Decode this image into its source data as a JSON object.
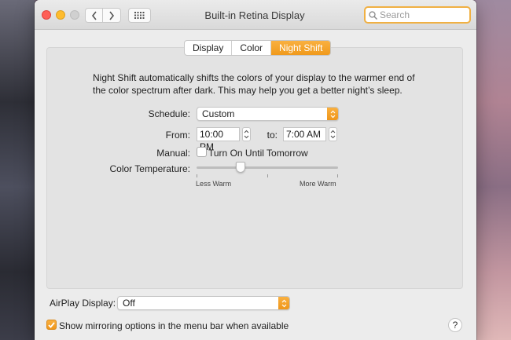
{
  "window": {
    "title": "Built-in Retina Display"
  },
  "toolbar": {
    "back_icon": "chevron-left-icon",
    "forward_icon": "chevron-right-icon",
    "grid_icon": "grid-icon"
  },
  "search": {
    "placeholder": "Search",
    "value": ""
  },
  "tabs": [
    {
      "label": "Display",
      "active": false
    },
    {
      "label": "Color",
      "active": false
    },
    {
      "label": "Night Shift",
      "active": true
    }
  ],
  "night_shift": {
    "description": "Night Shift automatically shifts the colors of your display to the warmer end of the color spectrum after dark. This may help you get a better night’s sleep.",
    "schedule_label": "Schedule:",
    "schedule_value": "Custom",
    "from_label": "From:",
    "from_value": "10:00 PM",
    "to_label": "to:",
    "to_value": "7:00 AM",
    "manual_label": "Manual:",
    "manual_checkbox_label": "Turn On Until Tomorrow",
    "manual_checked": false,
    "color_temp_label": "Color Temperature:",
    "color_temp_fraction": 0.31,
    "less_warm_label": "Less Warm",
    "more_warm_label": "More Warm"
  },
  "airplay": {
    "label": "AirPlay Display:",
    "value": "Off"
  },
  "mirroring": {
    "label": "Show mirroring options in the menu bar when available",
    "checked": true
  },
  "help": {
    "label": "?"
  },
  "colors": {
    "accent": "#f5a623",
    "close": "#fe5f57",
    "minimize": "#febc2e"
  }
}
